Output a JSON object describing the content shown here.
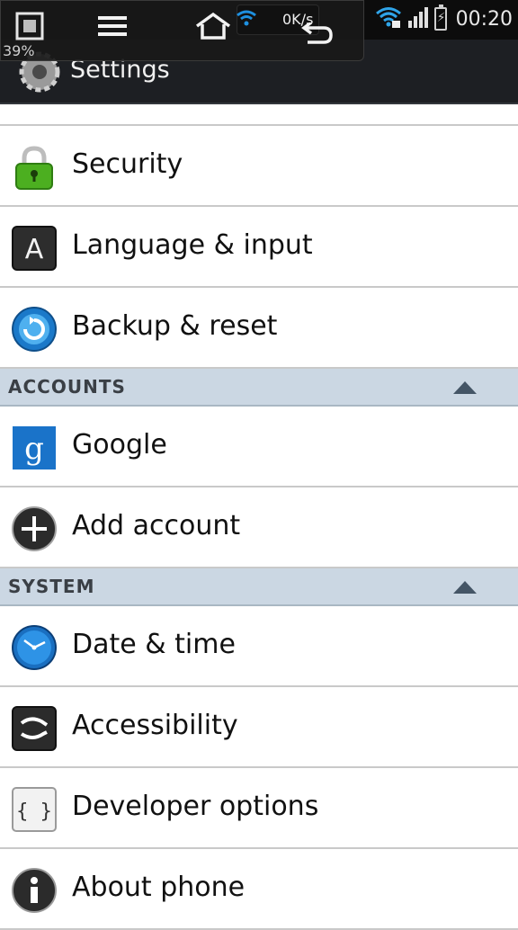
{
  "status_bar": {
    "time": "00:20"
  },
  "overlay": {
    "battery_percent": "39%",
    "net_speed": "0K/s"
  },
  "action_bar": {
    "title": "Settings"
  },
  "items_top": [
    {
      "label": "Security",
      "icon": "lock-icon"
    },
    {
      "label": "Language & input",
      "icon": "keyboard-a-icon"
    },
    {
      "label": "Backup & reset",
      "icon": "backup-icon"
    }
  ],
  "sections": {
    "accounts": {
      "title": "ACCOUNTS",
      "items": [
        {
          "label": "Google",
          "icon": "google-icon"
        },
        {
          "label": "Add account",
          "icon": "plus-circle-icon"
        }
      ]
    },
    "system": {
      "title": "SYSTEM",
      "items": [
        {
          "label": "Date & time",
          "icon": "clock-icon"
        },
        {
          "label": "Accessibility",
          "icon": "accessibility-hand-icon"
        },
        {
          "label": "Developer options",
          "icon": "braces-icon"
        },
        {
          "label": "About phone",
          "icon": "info-icon"
        }
      ]
    }
  },
  "colors": {
    "section_bg": "#cbd7e3",
    "action_bar_bg": "#1d1f23",
    "accent_blue": "#1a73c9"
  }
}
